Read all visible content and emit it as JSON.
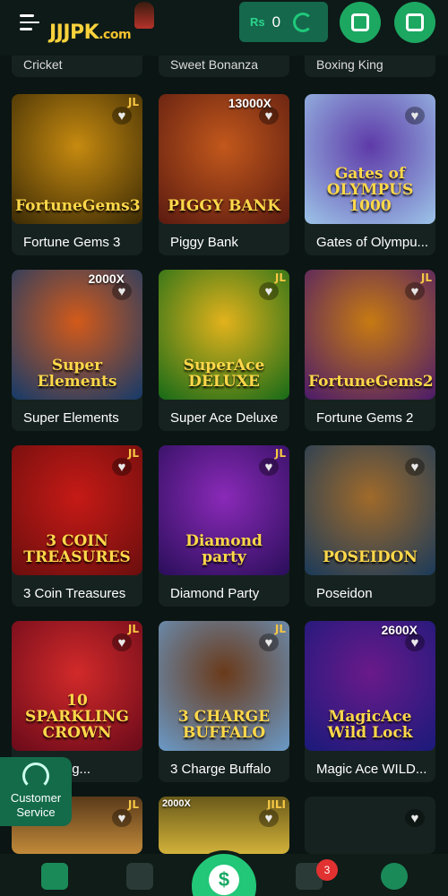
{
  "header": {
    "logo_text": "JJJPK",
    "logo_suffix": ".com",
    "currency": "Rs",
    "balance": "0"
  },
  "previous_row": [
    "Cricket",
    "Sweet Bonanza",
    "Boxing King"
  ],
  "games": [
    {
      "name": "Fortune Gems 3",
      "art": "FortuneGems3",
      "badge": "JL",
      "multiplier": "",
      "colors": [
        "#3a2a05",
        "#c68a10"
      ]
    },
    {
      "name": "Piggy Bank",
      "art": "PIGGY BANK",
      "badge": "",
      "multiplier": "13000X",
      "colors": [
        "#5a1a10",
        "#c2581c"
      ]
    },
    {
      "name": "Gates of Olympu...",
      "art": "Gates of OLYMPUS 1000",
      "badge": "",
      "multiplier": "",
      "colors": [
        "#9cc4e8",
        "#5e3aa8"
      ]
    },
    {
      "name": "Super Elements",
      "art": "Super Elements",
      "badge": "",
      "multiplier": "2000X",
      "colors": [
        "#143a6a",
        "#d35a1a"
      ]
    },
    {
      "name": "Super Ace Deluxe",
      "art": "SuperAce DELUXE",
      "badge": "JL",
      "multiplier": "",
      "colors": [
        "#156a18",
        "#e2b21c"
      ]
    },
    {
      "name": "Fortune Gems 2",
      "art": "FortuneGems2",
      "badge": "JL",
      "multiplier": "",
      "colors": [
        "#4a1a6a",
        "#c77a12"
      ]
    },
    {
      "name": "3 Coin Treasures",
      "art": "3 COIN TREASURES",
      "badge": "JL",
      "multiplier": "",
      "colors": [
        "#6a0e0e",
        "#c61a16"
      ]
    },
    {
      "name": "Diamond Party",
      "art": "Diamond party",
      "badge": "JL",
      "multiplier": "",
      "colors": [
        "#2a0e5a",
        "#8a2ab8"
      ]
    },
    {
      "name": "Poseidon",
      "art": "POSEIDON",
      "badge": "",
      "multiplier": "",
      "colors": [
        "#1a3a5a",
        "#a06a2a"
      ]
    },
    {
      "name": "Sparkling...",
      "art": "10 SPARKLING CROWN",
      "badge": "JL",
      "multiplier": "",
      "colors": [
        "#6a0a1a",
        "#d22a2a"
      ]
    },
    {
      "name": "3 Charge Buffalo",
      "art": "3 CHARGE BUFFALO",
      "badge": "JL",
      "multiplier": "",
      "colors": [
        "#6a9ac8",
        "#6a3a1a"
      ]
    },
    {
      "name": "Magic Ace WILD...",
      "art": "MagicAce Wild Lock",
      "badge": "",
      "multiplier": "2600X",
      "colors": [
        "#1a1a7a",
        "#6a1a8a"
      ]
    }
  ],
  "partial_row": [
    {
      "colors": [
        "#5a3a1a",
        "#c28a3a"
      ],
      "badge": "JL"
    },
    {
      "colors": [
        "#6a5a1a",
        "#d2b23a"
      ],
      "badge": "JILI",
      "ribbon": "2000X"
    },
    {
      "colors": [
        "#16221f",
        "#16221f"
      ],
      "badge": ""
    }
  ],
  "customer_service": {
    "line1": "Customer",
    "line2": "Service"
  },
  "bottom_nav": {
    "notification_count": "3",
    "center_icon": "$"
  },
  "icons": [
    "menu-icon",
    "refresh-icon",
    "deposit-icon",
    "withdraw-icon",
    "heart-icon",
    "headset-icon",
    "home-icon",
    "gift-icon",
    "wallet-icon",
    "chest-icon",
    "profile-icon"
  ]
}
